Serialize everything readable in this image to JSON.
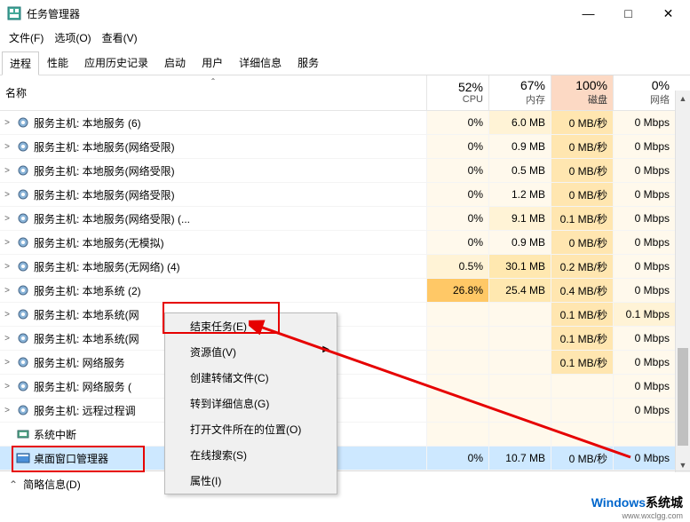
{
  "window": {
    "title": "任务管理器",
    "minimize": "—",
    "maximize": "□",
    "close": "✕"
  },
  "menu": {
    "file": "文件(F)",
    "options": "选项(O)",
    "view": "查看(V)"
  },
  "tabs": {
    "processes": "进程",
    "performance": "性能",
    "app_history": "应用历史记录",
    "startup": "启动",
    "users": "用户",
    "details": "详细信息",
    "services": "服务"
  },
  "columns": {
    "name": "名称",
    "cpu_pct": "52%",
    "cpu_lbl": "CPU",
    "mem_pct": "67%",
    "mem_lbl": "内存",
    "disk_pct": "100%",
    "disk_lbl": "磁盘",
    "net_pct": "0%",
    "net_lbl": "网络"
  },
  "rows": [
    {
      "exp": ">",
      "name": "服务主机: 本地服务 (6)",
      "cpu": "0%",
      "mem": "6.0 MB",
      "disk": "0 MB/秒",
      "net": "0 Mbps",
      "h": [
        0,
        1,
        3,
        0
      ]
    },
    {
      "exp": ">",
      "name": "服务主机: 本地服务(网络受限)",
      "cpu": "0%",
      "mem": "0.9 MB",
      "disk": "0 MB/秒",
      "net": "0 Mbps",
      "h": [
        0,
        0,
        3,
        0
      ]
    },
    {
      "exp": ">",
      "name": "服务主机: 本地服务(网络受限)",
      "cpu": "0%",
      "mem": "0.5 MB",
      "disk": "0 MB/秒",
      "net": "0 Mbps",
      "h": [
        0,
        0,
        3,
        0
      ]
    },
    {
      "exp": ">",
      "name": "服务主机: 本地服务(网络受限)",
      "cpu": "0%",
      "mem": "1.2 MB",
      "disk": "0 MB/秒",
      "net": "0 Mbps",
      "h": [
        0,
        0,
        3,
        0
      ]
    },
    {
      "exp": ">",
      "name": "服务主机: 本地服务(网络受限) (...",
      "cpu": "0%",
      "mem": "9.1 MB",
      "disk": "0.1 MB/秒",
      "net": "0 Mbps",
      "h": [
        0,
        1,
        3,
        0
      ]
    },
    {
      "exp": ">",
      "name": "服务主机: 本地服务(无模拟)",
      "cpu": "0%",
      "mem": "0.9 MB",
      "disk": "0 MB/秒",
      "net": "0 Mbps",
      "h": [
        0,
        0,
        3,
        0
      ]
    },
    {
      "exp": ">",
      "name": "服务主机: 本地服务(无网络) (4)",
      "cpu": "0.5%",
      "mem": "30.1 MB",
      "disk": "0.2 MB/秒",
      "net": "0 Mbps",
      "h": [
        1,
        2,
        3,
        0
      ]
    },
    {
      "exp": ">",
      "name": "服务主机: 本地系统 (2)",
      "cpu": "26.8%",
      "mem": "25.4 MB",
      "disk": "0.4 MB/秒",
      "net": "0 Mbps",
      "h": [
        4,
        2,
        3,
        0
      ]
    },
    {
      "exp": ">",
      "name": "服务主机: 本地系统(网",
      "cpu": "",
      "mem": "",
      "disk": "0.1 MB/秒",
      "net": "0.1 Mbps",
      "h": [
        0,
        0,
        3,
        1
      ]
    },
    {
      "exp": ">",
      "name": "服务主机: 本地系统(网",
      "cpu": "",
      "mem": "",
      "disk": "0.1 MB/秒",
      "net": "0 Mbps",
      "h": [
        0,
        0,
        3,
        0
      ]
    },
    {
      "exp": ">",
      "name": "服务主机: 网络服务",
      "cpu": "",
      "mem": "",
      "disk": "0.1 MB/秒",
      "net": "0 Mbps",
      "h": [
        0,
        0,
        3,
        0
      ]
    },
    {
      "exp": ">",
      "name": "服务主机: 网络服务 (",
      "cpu": "",
      "mem": "",
      "disk": "",
      "net": "0 Mbps",
      "h": [
        0,
        0,
        0,
        0
      ]
    },
    {
      "exp": ">",
      "name": "服务主机: 远程过程调",
      "cpu": "",
      "mem": "",
      "disk": "",
      "net": "0 Mbps",
      "h": [
        0,
        0,
        0,
        0
      ]
    },
    {
      "exp": "",
      "name": "系统中断",
      "cpu": "",
      "mem": "",
      "disk": "",
      "net": "",
      "h": [
        0,
        0,
        0,
        0
      ],
      "icon": "sys"
    },
    {
      "exp": "",
      "name": "桌面窗口管理器",
      "cpu": "0%",
      "mem": "10.7 MB",
      "disk": "0 MB/秒",
      "net": "0 Mbps",
      "h": [
        0,
        0,
        0,
        0
      ],
      "icon": "dwm",
      "selected": true
    }
  ],
  "context_menu": {
    "end_task": "结束任务(E)",
    "resource_values": "资源值(V)",
    "create_dump": "创建转储文件(C)",
    "go_to_details": "转到详细信息(G)",
    "open_file_location": "打开文件所在的位置(O)",
    "search_online": "在线搜索(S)",
    "properties": "属性(I)"
  },
  "footer": {
    "fewer_details": "简略信息(D)"
  },
  "watermark": {
    "brand_en": "Windows",
    "brand_cn": "系统城",
    "url": "www.wxclgg.com"
  }
}
